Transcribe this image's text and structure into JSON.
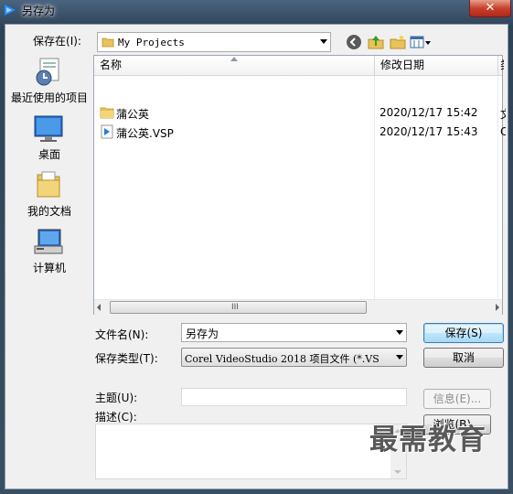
{
  "window": {
    "title": "另存为",
    "close_glyph": "✕"
  },
  "toolbar": {
    "lookin_label": "保存在",
    "lookin_key": "(I)",
    "lookin_value": "My Projects",
    "icons": [
      "back-icon",
      "up-folder-icon",
      "new-folder-icon",
      "view-menu-icon"
    ]
  },
  "places": [
    {
      "label": "最近使用的项目",
      "icon": "recent-items-icon"
    },
    {
      "label": "桌面",
      "icon": "desktop-icon"
    },
    {
      "label": "我的文档",
      "icon": "my-documents-icon"
    },
    {
      "label": "计算机",
      "icon": "computer-icon"
    }
  ],
  "filelist": {
    "columns": [
      "名称",
      "修改日期",
      "类"
    ],
    "rows": [
      {
        "name": "蒲公英",
        "date": "2020/12/17 15:42",
        "extra": "文",
        "icon": "folder-icon"
      },
      {
        "name": "蒲公英.VSP",
        "date": "2020/12/17 15:43",
        "extra": "C",
        "icon": "videostudio-file-icon"
      }
    ],
    "scroll_grip": "III"
  },
  "form": {
    "filename_label": "文件名(N):",
    "filename_value": "另存为",
    "filetype_label": "保存类型(T):",
    "filetype_value": "Corel VideoStudio 2018 项目文件 (*.VS",
    "subject_label": "主题(U):",
    "subject_value": "",
    "desc_label": "描述(C):",
    "desc_value": ""
  },
  "buttons": {
    "save": "保存(S)",
    "cancel": "取消",
    "info": "信息(E)...",
    "browse": "浏览(B)..."
  },
  "watermark": "最需教育",
  "colors": {
    "accent": "#3c7fb1",
    "folder": "#e8c25a",
    "title_bar": "#3b4f63"
  }
}
